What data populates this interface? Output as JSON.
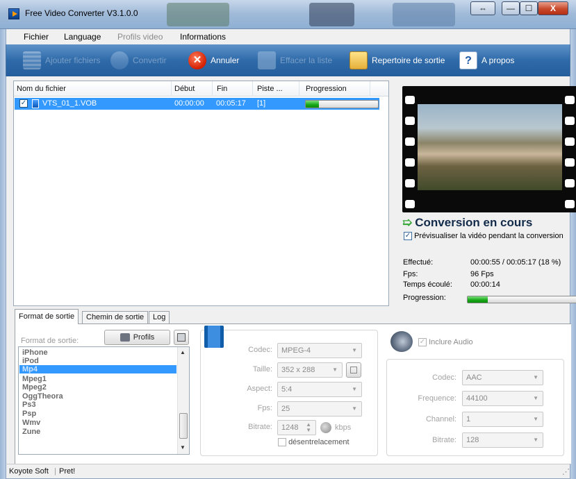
{
  "window": {
    "title": "Free Video Converter V3.1.0.0",
    "buttons": {
      "resize": "⇔",
      "minimize": "—",
      "maximize": "☐",
      "close": "X"
    }
  },
  "menu": {
    "items": [
      "Fichier",
      "Language",
      "Profils video",
      "Informations"
    ]
  },
  "toolbar": {
    "add_files": "Ajouter fichiers",
    "convert": "Convertir",
    "cancel": "Annuler",
    "clear_list": "Effacer la liste",
    "output_dir": "Repertoire de sortie",
    "about": "A propos"
  },
  "file_list": {
    "columns": [
      "Nom du fichier",
      "Début",
      "Fin",
      "Piste ...",
      "Progression"
    ],
    "rows": [
      {
        "name": "VTS_01_1.VOB",
        "start": "00:00:00",
        "end": "00:05:17",
        "track": "[1]",
        "progress": 0.18,
        "checked": true
      }
    ]
  },
  "preview": {
    "status_title": "Conversion en cours",
    "preview_checkbox_label": "Prévisualiser la vidéo pendant la conversion",
    "stats": {
      "done_label": "Effectué:",
      "done_value": "00:00:55 / 00:05:17  (18 %)",
      "fps_label": "Fps:",
      "fps_value": "96 Fps",
      "elapsed_label": "Temps écoulé:",
      "elapsed_value": "00:00:14",
      "progress_label": "Progression:",
      "progress": 0.18
    }
  },
  "tabs": [
    "Format de sortie",
    "Chemin de sortie",
    "Log"
  ],
  "format_panel": {
    "label": "Format de sortie:",
    "profiles_button": "Profils",
    "formats": [
      "iPhone",
      "iPod",
      "Mp4",
      "Mpeg1",
      "Mpeg2",
      "OggTheora",
      "Ps3",
      "Psp",
      "Wmv",
      "Zune"
    ],
    "selected_format": "Mp4"
  },
  "video_settings": {
    "codec_label": "Codec:",
    "codec": "MPEG-4",
    "size_label": "Taille:",
    "size": "352 x 288",
    "aspect_label": "Aspect:",
    "aspect": "5:4",
    "fps_label": "Fps:",
    "fps": "25",
    "bitrate_label": "Bitrate:",
    "bitrate": "1248",
    "bitrate_unit": "kbps",
    "deinterlace_label": "désentrelacement"
  },
  "audio_settings": {
    "include_audio_label": "Inclure Audio",
    "codec_label": "Codec:",
    "codec": "AAC",
    "frequency_label": "Frequence:",
    "frequency": "44100",
    "channel_label": "Channel:",
    "channel": "1",
    "bitrate_label": "Bitrate:",
    "bitrate": "128"
  },
  "statusbar": {
    "company": "Koyote Soft",
    "status": "Pret!"
  }
}
